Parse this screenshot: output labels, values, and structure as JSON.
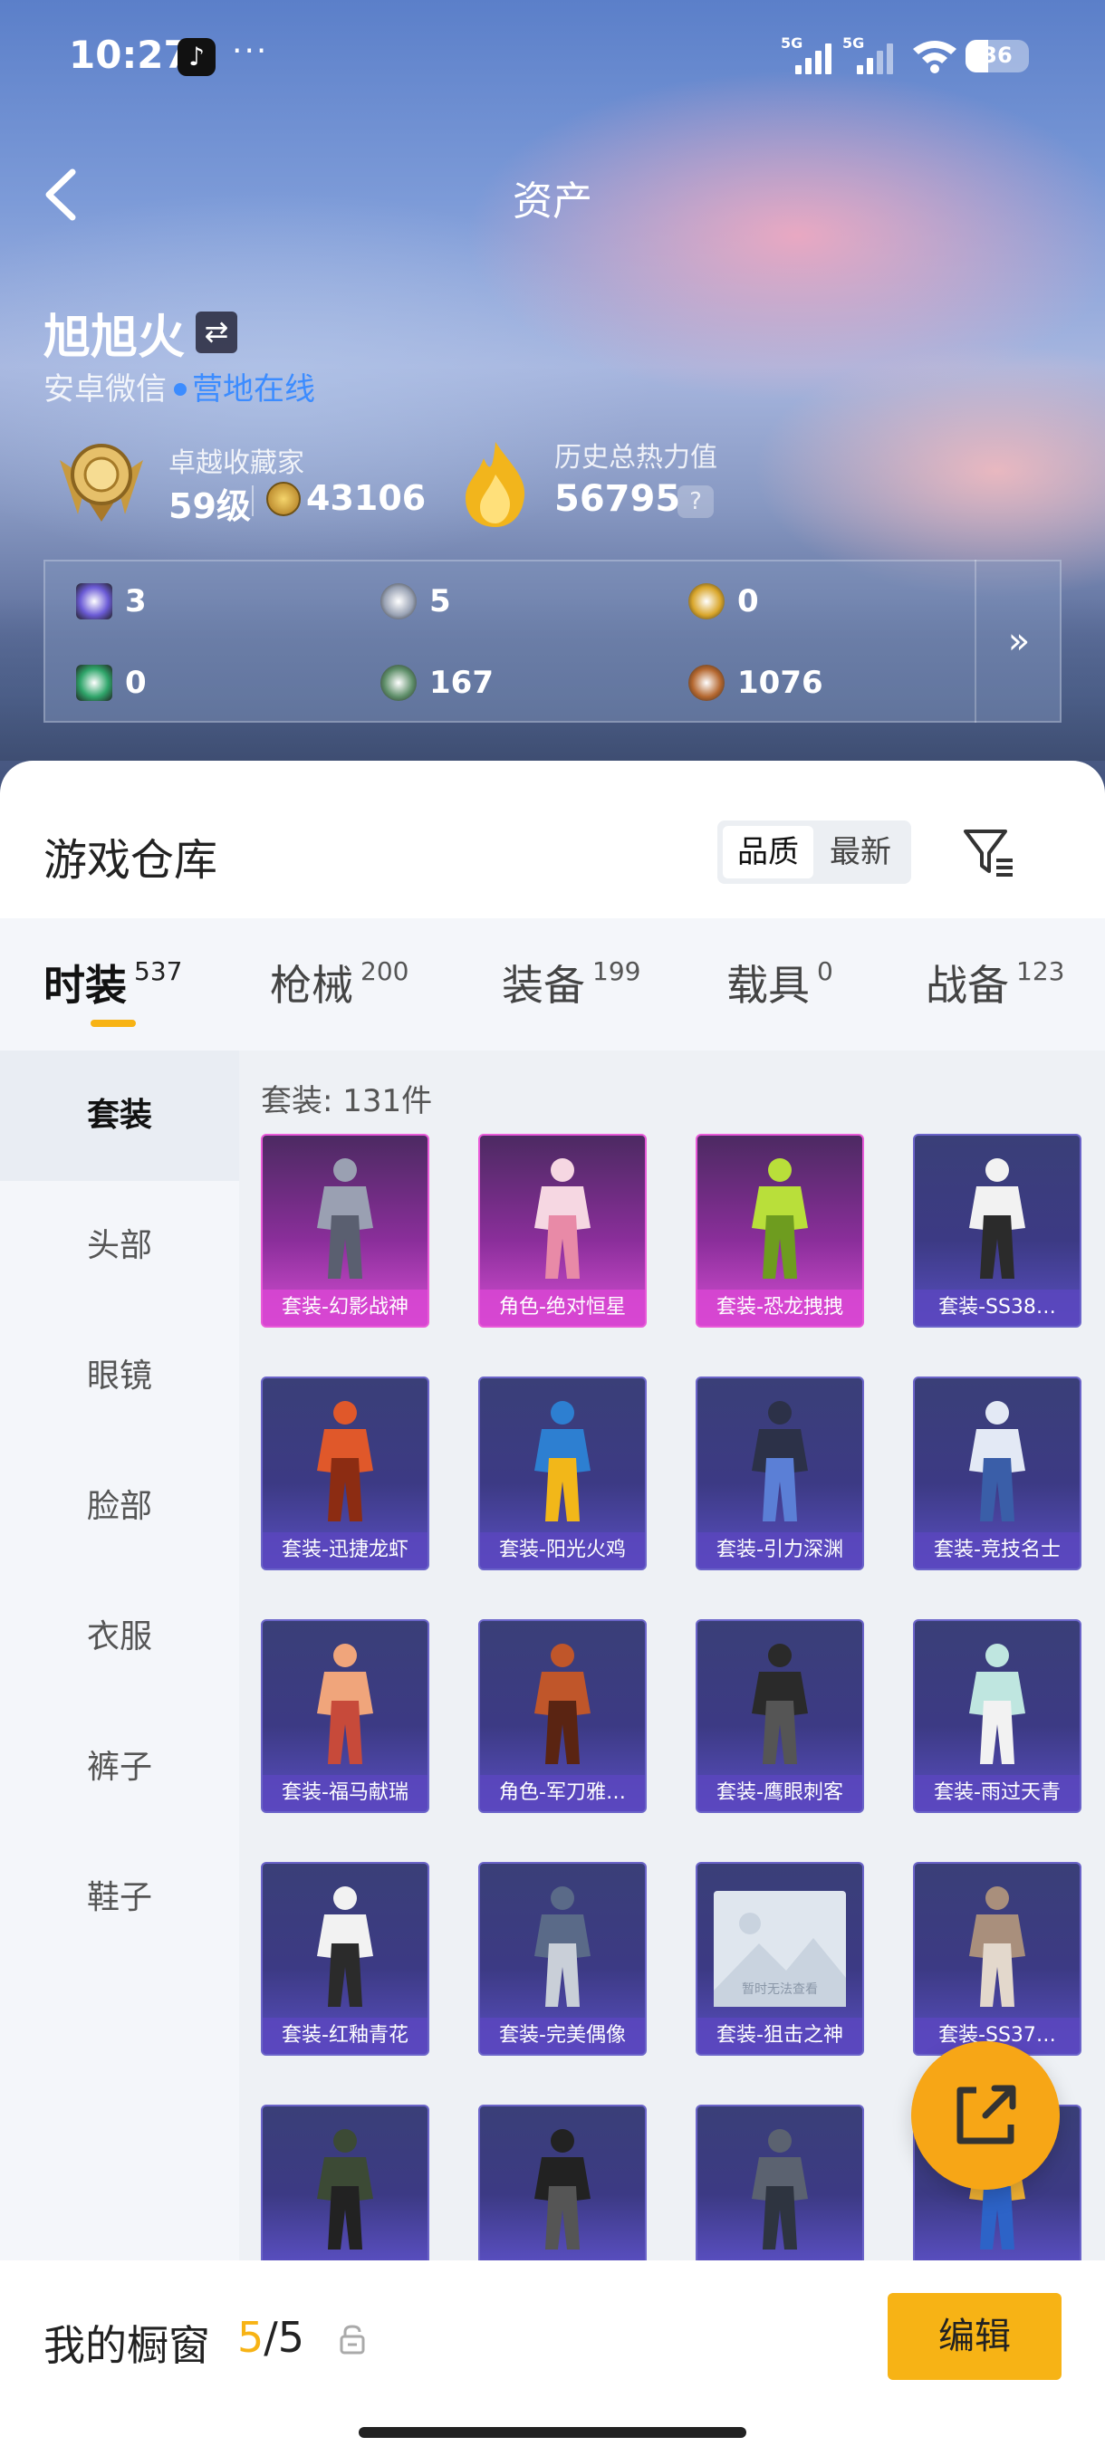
{
  "status_bar": {
    "time": "10:27",
    "more": "···",
    "signal1_label": "5G",
    "signal2_label": "5G",
    "battery": "36",
    "battery_level": 0.36
  },
  "header": {
    "title": "资产",
    "player_name": "旭旭火",
    "switch_icon": "⇄",
    "platform": "安卓微信",
    "online_status": "营地在线",
    "collector_title": "卓越收藏家",
    "collector_level": "59级",
    "collector_points": "43106",
    "heat_title": "历史总热力值",
    "heat_value": "56795",
    "help": "?"
  },
  "currencies": [
    {
      "icon": "purple-card-icon",
      "value": "3",
      "color": "#6b5bd6"
    },
    {
      "icon": "silver-coin-icon",
      "value": "5",
      "color": "#9aa3b5"
    },
    {
      "icon": "gold-coin-icon",
      "value": "0",
      "color": "#d9a62b"
    },
    {
      "icon": "green-card-icon",
      "value": "0",
      "color": "#2fa56a"
    },
    {
      "icon": "green-orb-icon",
      "value": "167",
      "color": "#5f8f6a"
    },
    {
      "icon": "bronze-coin-icon",
      "value": "1076",
      "color": "#b4672f"
    }
  ],
  "currency_more": "»",
  "warehouse": {
    "title": "游戏仓库",
    "sort": [
      "品质",
      "最新"
    ],
    "tabs": [
      {
        "label": "时装",
        "count": "537"
      },
      {
        "label": "枪械",
        "count": "200"
      },
      {
        "label": "装备",
        "count": "199"
      },
      {
        "label": "载具",
        "count": "0"
      },
      {
        "label": "战备",
        "count": "123"
      }
    ],
    "categories": [
      "套装",
      "头部",
      "眼镜",
      "脸部",
      "衣服",
      "裤子",
      "鞋子"
    ],
    "count_label": "套装: 131件",
    "placeholder_text": "暂时无法查看",
    "items": [
      {
        "name": "套装-幻影战神",
        "rarity": "legendary"
      },
      {
        "name": "角色-绝对恒星",
        "rarity": "legendary"
      },
      {
        "name": "套装-恐龙拽拽",
        "rarity": "legendary"
      },
      {
        "name": "套装-SS38…",
        "rarity": "epic"
      },
      {
        "name": "套装-迅捷龙虾",
        "rarity": "epic"
      },
      {
        "name": "套装-阳光火鸡",
        "rarity": "epic"
      },
      {
        "name": "套装-引力深渊",
        "rarity": "epic"
      },
      {
        "name": "套装-竞技名士",
        "rarity": "epic"
      },
      {
        "name": "套装-福马献瑞",
        "rarity": "epic"
      },
      {
        "name": "角色-军刀雅…",
        "rarity": "epic"
      },
      {
        "name": "套装-鹰眼刺客",
        "rarity": "epic"
      },
      {
        "name": "套装-雨过天青",
        "rarity": "epic"
      },
      {
        "name": "套装-红釉青花",
        "rarity": "epic"
      },
      {
        "name": "套装-完美偶像",
        "rarity": "epic"
      },
      {
        "name": "套装-狙击之神",
        "rarity": "epic"
      },
      {
        "name": "套装-SS37…",
        "rarity": "epic"
      },
      {
        "name": "",
        "rarity": "epic"
      },
      {
        "name": "",
        "rarity": "epic"
      },
      {
        "name": "",
        "rarity": "epic"
      },
      {
        "name": "",
        "rarity": "epic"
      }
    ]
  },
  "showcase": {
    "label": "我的橱窗",
    "current": "5",
    "total": "/5",
    "edit": "编辑"
  },
  "colors": {
    "accent": "#f7b315",
    "online": "#3c8cff",
    "legendary": "#d64fd4",
    "epic": "#5a4fc2"
  }
}
